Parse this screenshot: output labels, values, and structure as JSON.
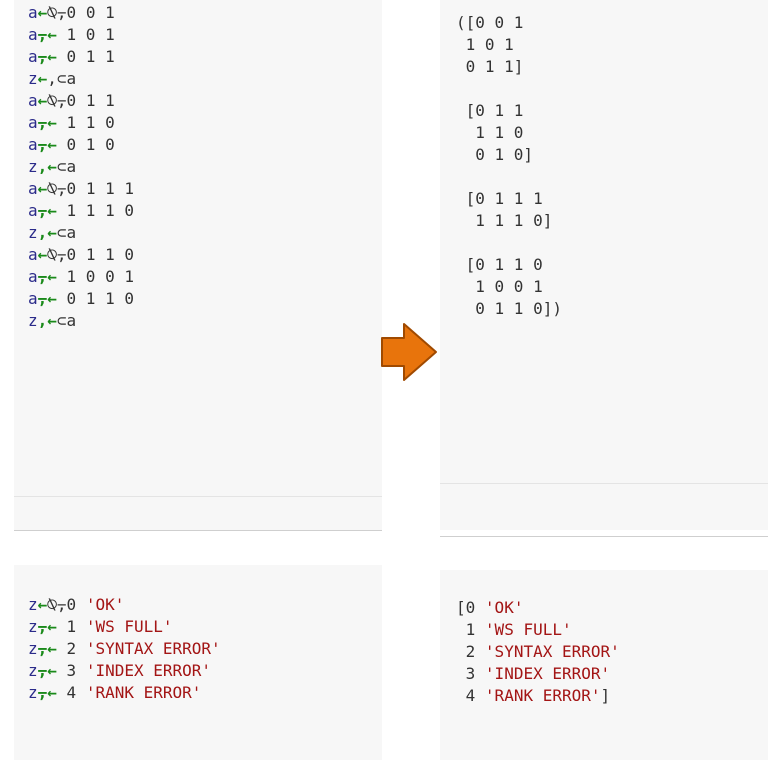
{
  "left_code": [
    {
      "lhs": "a",
      "arrow": "←",
      "op": "⍉⍪",
      "tail": "0 0 1"
    },
    {
      "lhs": "a",
      "arrow": "⍪←",
      "op": "",
      "tail": " 1 0 1"
    },
    {
      "lhs": "a",
      "arrow": "⍪←",
      "op": "",
      "tail": " 0 1 1"
    },
    {
      "lhs": "z",
      "arrow": "←",
      "op": ",⊂a",
      "tail": ""
    },
    {
      "lhs": "a",
      "arrow": "←",
      "op": "⍉⍪",
      "tail": "0 1 1"
    },
    {
      "lhs": "a",
      "arrow": "⍪←",
      "op": "",
      "tail": " 1 1 0"
    },
    {
      "lhs": "a",
      "arrow": "⍪←",
      "op": "",
      "tail": " 0 1 0"
    },
    {
      "lhs": "z",
      "arrow": ",←",
      "op": "⊂a",
      "tail": ""
    },
    {
      "lhs": "a",
      "arrow": "←",
      "op": "⍉⍪",
      "tail": "0 1 1 1"
    },
    {
      "lhs": "a",
      "arrow": "⍪←",
      "op": "",
      "tail": " 1 1 1 0"
    },
    {
      "lhs": "z",
      "arrow": ",←",
      "op": "⊂a",
      "tail": ""
    },
    {
      "lhs": "a",
      "arrow": "←",
      "op": "⍉⍪",
      "tail": "0 1 1 0"
    },
    {
      "lhs": "a",
      "arrow": "⍪←",
      "op": "",
      "tail": " 1 0 0 1"
    },
    {
      "lhs": "a",
      "arrow": "⍪←",
      "op": "",
      "tail": " 0 1 1 0"
    },
    {
      "lhs": "z",
      "arrow": ",←",
      "op": "⊂a",
      "tail": ""
    }
  ],
  "left_code2": [
    {
      "lhs": "z",
      "arrow": "←",
      "op": "⍉⍪",
      "num": "0",
      "str": "'OK'"
    },
    {
      "lhs": "z",
      "arrow": "⍪←",
      "op": "",
      "num": " 1",
      "str": "'WS FULL'"
    },
    {
      "lhs": "z",
      "arrow": "⍪←",
      "op": "",
      "num": " 2",
      "str": "'SYNTAX ERROR'"
    },
    {
      "lhs": "z",
      "arrow": "⍪←",
      "op": "",
      "num": " 3",
      "str": "'INDEX ERROR'"
    },
    {
      "lhs": "z",
      "arrow": "⍪←",
      "op": "",
      "num": " 4",
      "str": "'RANK ERROR'"
    }
  ],
  "right_out": [
    "([0 0 1",
    " 1 0 1",
    " 0 1 1]",
    "",
    " [0 1 1",
    "  1 1 0",
    "  0 1 0]",
    "",
    " [0 1 1 1",
    "  1 1 1 0]",
    "",
    " [0 1 1 0",
    "  1 0 0 1",
    "  0 1 1 0])"
  ],
  "right_out2": [
    {
      "pre": "[",
      "num": "0",
      "str": "'OK'",
      "post": ""
    },
    {
      "pre": " ",
      "num": "1",
      "str": "'WS FULL'",
      "post": ""
    },
    {
      "pre": " ",
      "num": "2",
      "str": "'SYNTAX ERROR'",
      "post": ""
    },
    {
      "pre": " ",
      "num": "3",
      "str": "'INDEX ERROR'",
      "post": ""
    },
    {
      "pre": " ",
      "num": "4",
      "str": "'RANK ERROR'",
      "post": "]"
    }
  ],
  "colors": {
    "arrow_fill": "#e8740c",
    "arrow_stroke": "#a04a00",
    "string": "#a31515",
    "assign_arrow": "#1a8a1a"
  }
}
